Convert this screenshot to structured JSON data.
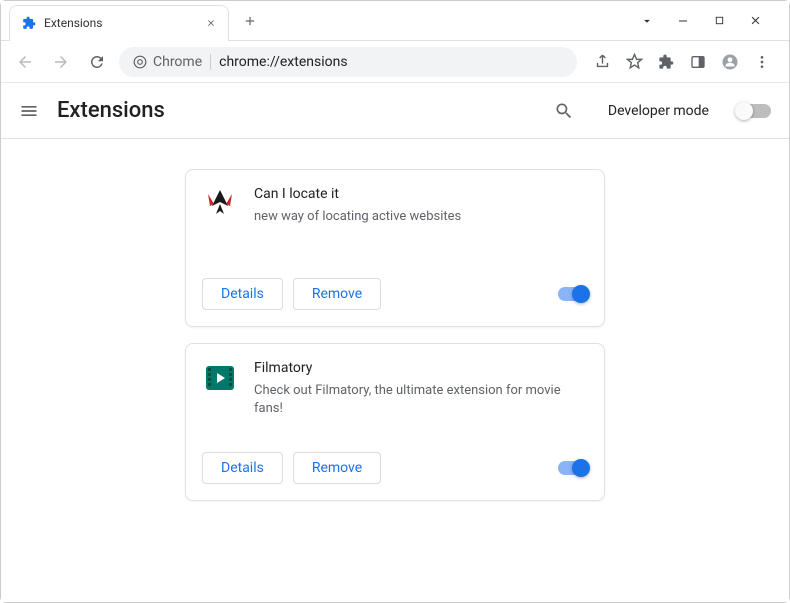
{
  "window": {
    "tab_title": "Extensions",
    "omnibox_prefix": "Chrome",
    "omnibox_path": "chrome://extensions"
  },
  "header": {
    "title": "Extensions",
    "dev_mode_label": "Developer mode",
    "dev_mode_on": false
  },
  "buttons": {
    "details": "Details",
    "remove": "Remove"
  },
  "extensions": [
    {
      "name": "Can I locate it",
      "description": "new way of locating active websites",
      "enabled": true,
      "icon": "phoenix"
    },
    {
      "name": "Filmatory",
      "description": "Check out Filmatory, the ultimate extension for movie fans!",
      "enabled": true,
      "icon": "film"
    }
  ],
  "colors": {
    "primary_blue": "#1a73e8",
    "text": "#202124",
    "muted": "#5f6368"
  }
}
